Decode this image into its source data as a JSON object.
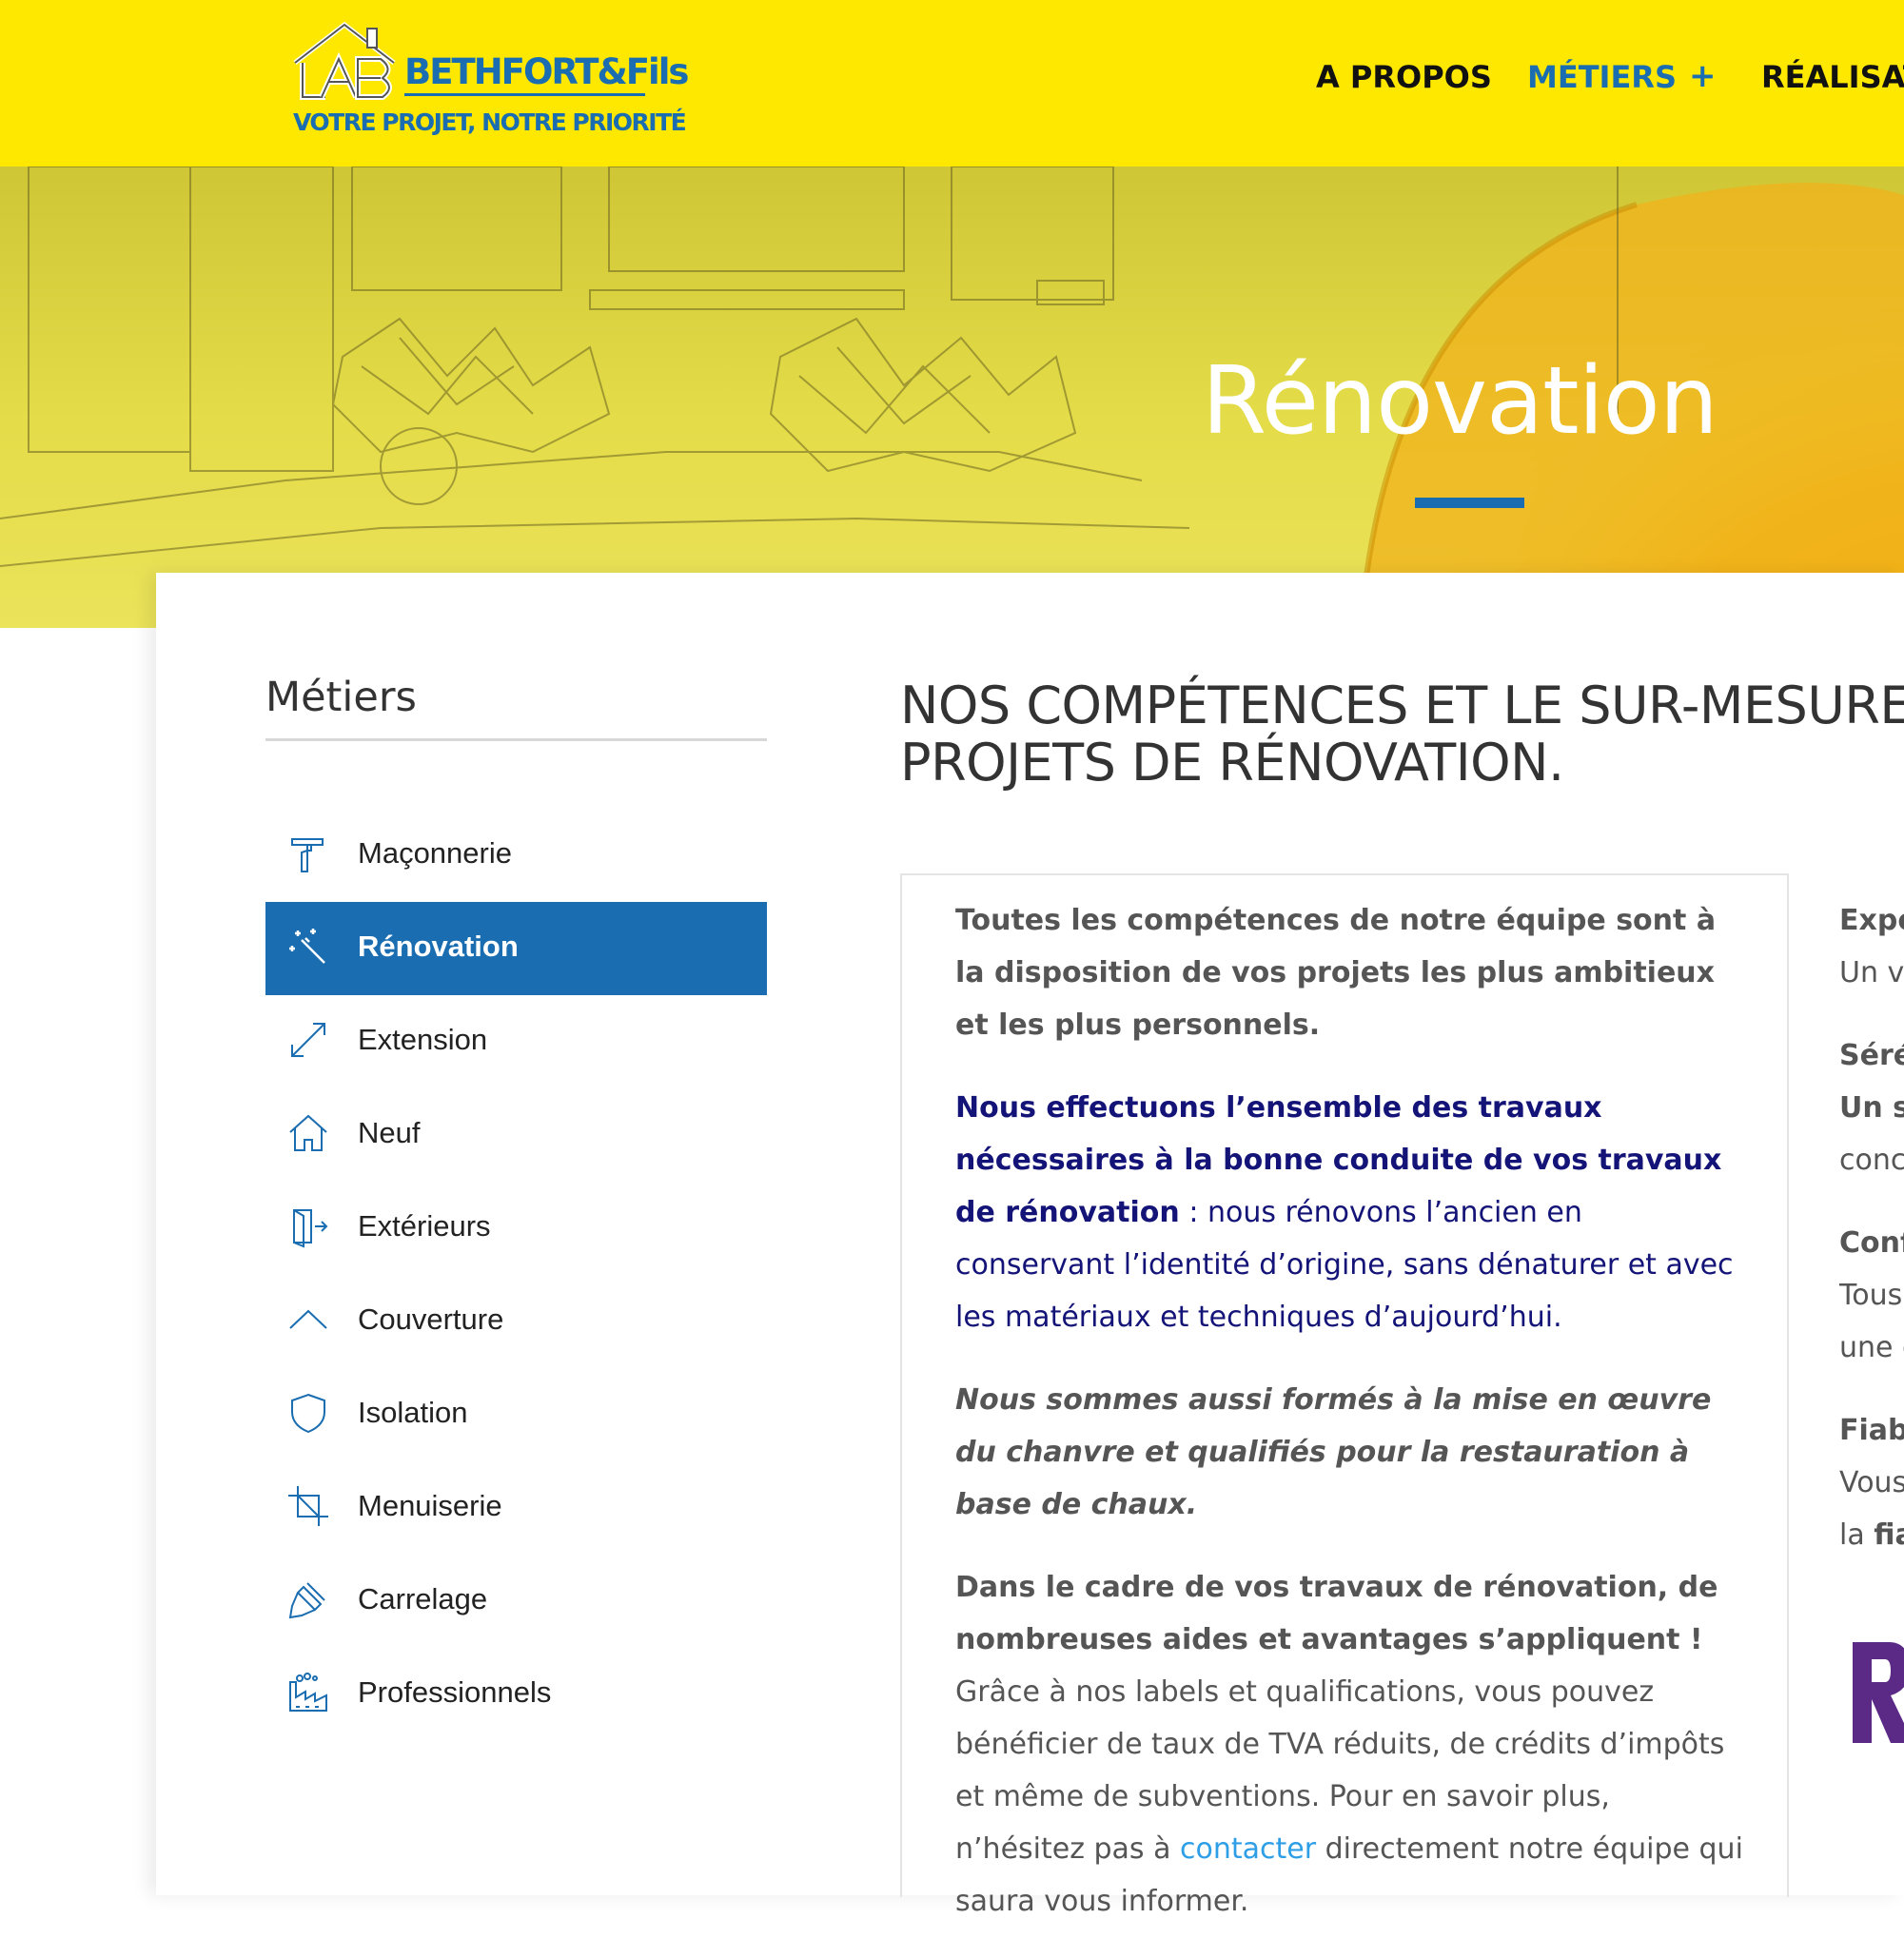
{
  "header": {
    "logo_name": "BETHFORT&Fils",
    "logo_tagline": "VOTRE PROJET, NOTRE PRIORITÉ",
    "nav": [
      {
        "label": "A PROPOS",
        "active": false
      },
      {
        "label": "MÉTIERS",
        "active": true,
        "has_submenu": true,
        "submenu_icon": "+"
      },
      {
        "label": "RÉALISAT",
        "active": false
      }
    ]
  },
  "hero": {
    "title": "Rénovation"
  },
  "sidebar": {
    "title": "Métiers",
    "items": [
      {
        "label": "Maçonnerie",
        "icon": "trowel-icon",
        "active": false
      },
      {
        "label": "Rénovation",
        "icon": "magic-wand-icon",
        "active": true
      },
      {
        "label": "Extension",
        "icon": "expand-arrows-icon",
        "active": false
      },
      {
        "label": "Neuf",
        "icon": "house-icon",
        "active": false
      },
      {
        "label": "Extérieurs",
        "icon": "door-exit-icon",
        "active": false
      },
      {
        "label": "Couverture",
        "icon": "chevron-up-icon",
        "active": false
      },
      {
        "label": "Isolation",
        "icon": "shield-icon",
        "active": false
      },
      {
        "label": "Menuiserie",
        "icon": "crop-icon",
        "active": false
      },
      {
        "label": "Carrelage",
        "icon": "paint-brush-icon",
        "active": false
      },
      {
        "label": "Professionnels",
        "icon": "factory-icon",
        "active": false
      }
    ]
  },
  "main": {
    "title_line1": "NOS COMPÉTENCES ET LE SUR-MESURE",
    "title_line2": "PROJETS DE RÉNOVATION.",
    "col1": {
      "p1": "Toutes les compétences de notre équipe sont à la disposition de vos projets les plus ambitieux et les plus personnels.",
      "p2_bold": "Nous effectuons l’ensemble des travaux nécessaires à la bonne conduite de vos travaux de rénovation",
      "p2_rest": " : nous rénovons l’ancien en conservant l’identité d’origine, sans dénaturer et avec les matériaux et techniques d’aujourd’hui.",
      "p3": "Nous sommes aussi formés à la mise en œuvre du chanvre et qualifiés pour la restauration à base de chaux.",
      "p4_bold": "Dans le cadre de vos travaux de rénovation, de nombreuses aides et avantages s’appliquent !",
      "p4_rest_a": " Grâce à nos labels et qualifications, vous pouvez bénéficier de taux de TVA réduits, de crédits d’impôts et même de subventions. Pour en savoir plus, n’hésitez pas à ",
      "p4_link": "contacter",
      "p4_rest_b": " directement notre équipe qui saura vous informer."
    },
    "col2_fragments": {
      "l1": "Expé",
      "l2": "Un v",
      "l3": "Séré",
      "l4": "Un s",
      "l5": "conc",
      "l6": "Conf",
      "l7": "Tous",
      "l8": "une g",
      "l9": "Fiab",
      "l10": "Vous",
      "l11_a": "la ",
      "l11_b": "fia",
      "logo_letter": "R"
    }
  },
  "colors": {
    "header_yellow": "#ffe800",
    "brand_blue": "#1a6db0",
    "navy_text": "#141478",
    "link_blue": "#2e9ee6",
    "purple_logo": "#5b2a86"
  }
}
